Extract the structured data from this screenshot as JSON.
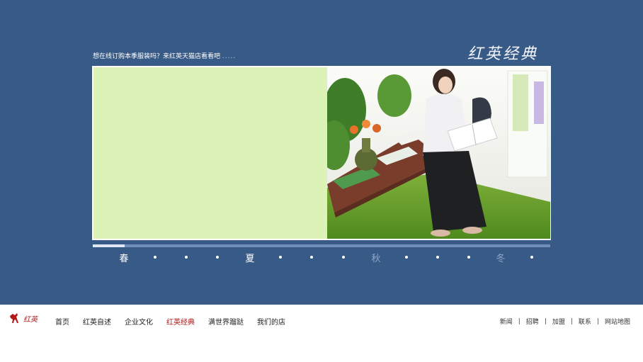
{
  "header": {
    "promo_text": "想在线订购本季服装吗？来红英天猫店看看吧",
    "promo_dots": ".....",
    "brand_title": "红英经典"
  },
  "slider": {
    "progress_fraction": 0.07,
    "seasons": [
      {
        "label": "春",
        "state": "active"
      },
      {
        "label": "夏",
        "state": "active"
      },
      {
        "label": "秋",
        "state": "dim"
      },
      {
        "label": "冬",
        "state": "dim"
      }
    ],
    "dots_between": 3
  },
  "footer": {
    "logo_text": "红英",
    "nav": [
      "首页",
      "红英自述",
      "企业文化",
      "红英经典",
      "满世界蹓跶",
      "我们的店"
    ],
    "active_nav": "红英经典",
    "links": [
      "新闻",
      "招聘",
      "加盟",
      "联系",
      "网站地图"
    ]
  },
  "colors": {
    "background": "#375a87",
    "panel": "#dcf2b7",
    "accent_red": "#b2191b"
  }
}
